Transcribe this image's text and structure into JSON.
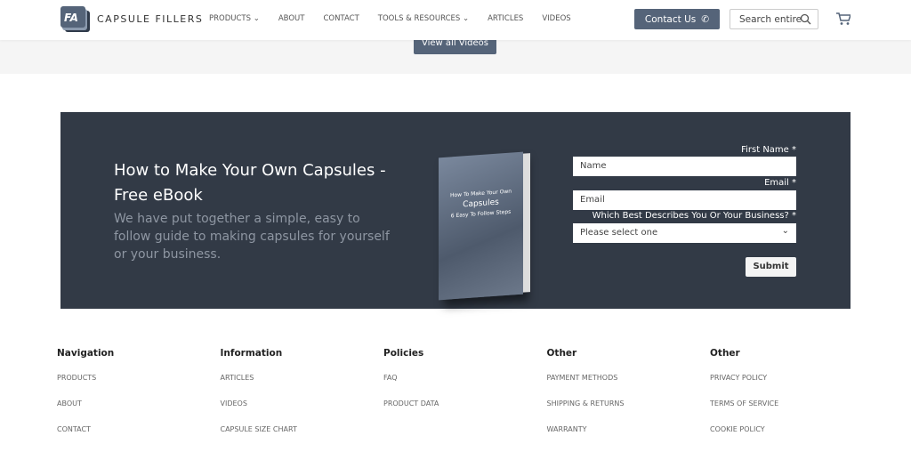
{
  "header": {
    "brand": "CAPSULE FILLERS",
    "logo_text": "FA",
    "nav": [
      "PRODUCTS ⌄",
      "ABOUT",
      "CONTACT",
      "TOOLS & RESOURCES ⌄",
      "ARTICLES",
      "VIDEOS"
    ],
    "contact_label": "Contact Us",
    "search_placeholder": "Search entire"
  },
  "band": {
    "view_videos": "View all Videos"
  },
  "promo": {
    "title": "How to Make Your Own Capsules - Free eBook",
    "description": "We have put together a simple, easy to follow guide to making capsules for yourself or your business.",
    "book": {
      "line1": "How To Make Your Own",
      "line2": "Capsules",
      "line3": "6 Easy To Follow Steps"
    },
    "form": {
      "first_name_label": "First Name *",
      "first_name_placeholder": "Name",
      "email_label": "Email *",
      "email_placeholder": "Email",
      "business_label": "Which Best Describes You Or Your Business? *",
      "business_value": "Please select one",
      "submit": "Submit"
    }
  },
  "footer": [
    {
      "title": "Navigation",
      "items": [
        "PRODUCTS",
        "ABOUT",
        "CONTACT"
      ]
    },
    {
      "title": "Information",
      "items": [
        "ARTICLES",
        "VIDEOS",
        "CAPSULE SIZE CHART"
      ]
    },
    {
      "title": "Policies",
      "items": [
        "FAQ",
        "PRODUCT DATA"
      ]
    },
    {
      "title": "Other",
      "items": [
        "PAYMENT METHODS",
        "SHIPPING & RETURNS",
        "WARRANTY"
      ]
    },
    {
      "title": "Other",
      "items": [
        "PRIVACY POLICY",
        "TERMS OF SERVICE",
        "COOKIE POLICY"
      ]
    }
  ],
  "colors": {
    "accent": "#556479",
    "promo_bg": "#323a46"
  }
}
